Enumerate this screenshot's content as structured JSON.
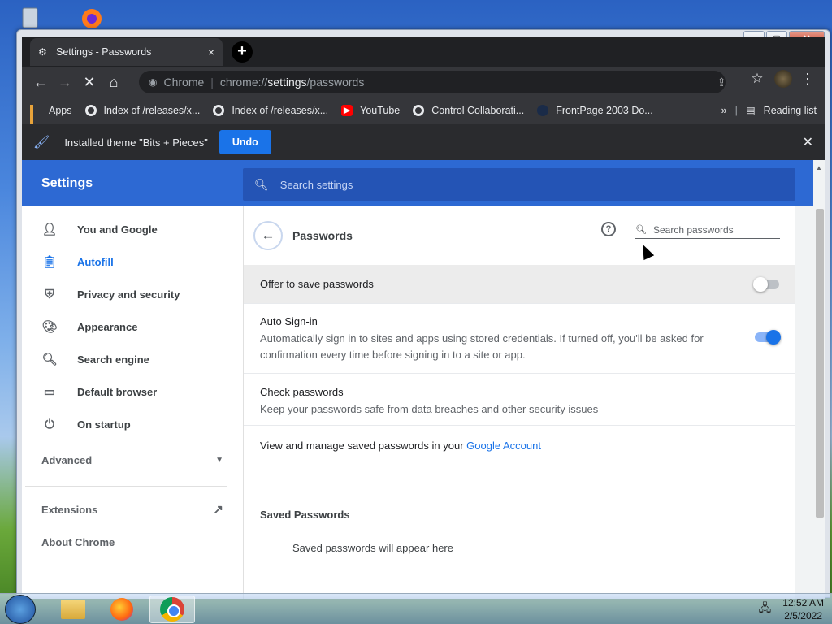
{
  "window": {
    "title": "Settings - Passwords"
  },
  "tab": {
    "title": "Settings - Passwords",
    "close": "×",
    "new_tab": "+"
  },
  "omnibox": {
    "site": "Chrome",
    "url_prefix": "chrome://",
    "url_host": "settings",
    "url_path": "/passwords"
  },
  "bookmarks": {
    "items": [
      {
        "label": "Apps"
      },
      {
        "label": "Index of /releases/x..."
      },
      {
        "label": "Index of /releases/x..."
      },
      {
        "label": "YouTube"
      },
      {
        "label": "Control Collaborati..."
      },
      {
        "label": "FrontPage 2003 Do..."
      }
    ],
    "more": "»",
    "reading_list": "Reading list"
  },
  "infobar": {
    "message": "Installed theme \"Bits + Pieces\"",
    "undo": "Undo",
    "close": "✕"
  },
  "settings": {
    "title": "Settings",
    "search_placeholder": "Search settings"
  },
  "sidebar": {
    "items": [
      {
        "label": "You and Google",
        "icon": "person-icon"
      },
      {
        "label": "Autofill",
        "icon": "clipboard-icon",
        "active": true
      },
      {
        "label": "Privacy and security",
        "icon": "shield-icon"
      },
      {
        "label": "Appearance",
        "icon": "palette-icon"
      },
      {
        "label": "Search engine",
        "icon": "search-icon"
      },
      {
        "label": "Default browser",
        "icon": "browser-icon"
      },
      {
        "label": "On startup",
        "icon": "power-icon"
      }
    ],
    "advanced": "Advanced",
    "extensions": "Extensions",
    "about": "About Chrome"
  },
  "passwords": {
    "title": "Passwords",
    "search_placeholder": "Search passwords",
    "offer_save": {
      "label": "Offer to save passwords",
      "enabled": false
    },
    "auto_signin": {
      "label": "Auto Sign-in",
      "description": "Automatically sign in to sites and apps using stored credentials. If turned off, you'll be asked for confirmation every time before signing in to a site or app.",
      "enabled": true
    },
    "check": {
      "label": "Check passwords",
      "description": "Keep your passwords safe from data breaches and other security issues"
    },
    "manage_text": "View and manage saved passwords in your ",
    "manage_link": "Google Account",
    "saved_heading": "Saved Passwords",
    "empty_text": "Saved passwords will appear here"
  },
  "taskbar": {
    "time": "12:52 AM",
    "date": "2/5/2022"
  },
  "colors": {
    "accent": "#1a73e8",
    "header": "#2d69d3"
  }
}
